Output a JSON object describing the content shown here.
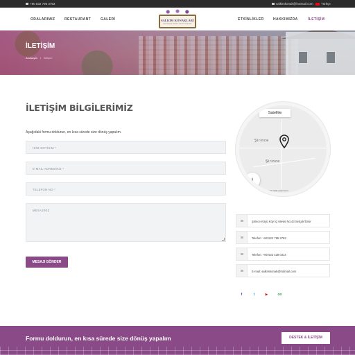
{
  "topbar": {
    "phone": "+90 532 795 3763",
    "email": "salkimkonak@hotmail.com",
    "language": "Türkçe"
  },
  "nav": {
    "left": [
      "ODALARIMIZ",
      "RESTAURANT",
      "GALERİ"
    ],
    "right": [
      "ETKİNLİKLER",
      "HAKKIMIZDA",
      "İLETİŞİM"
    ]
  },
  "logo": {
    "name": "SALKIM KONAKLARI",
    "tagline": "BOUTIQUE HOTEL & RESTAURANT"
  },
  "hero": {
    "title": "İLETİŞİM",
    "breadcrumb_home": "Anasayfa",
    "breadcrumb_sep": "/",
    "breadcrumb_current": "İletişim"
  },
  "contact": {
    "title": "İLETİŞİM BİLGİLERİMİZ",
    "intro": "Aşağıdaki formu doldurun, en kısa sürede size dönüş yapalım.",
    "name_placeholder": "İSİM SOYİSİM *",
    "email_placeholder": "E-MAİL ADRESİNİZ *",
    "phone_placeholder": "TELEFON NO *",
    "message_placeholder": "MESAJINIZ",
    "submit_label": "MESAJI GÖNDER"
  },
  "map": {
    "satellite_label": "Satellite",
    "place_label_1": "Şirince",
    "place_label_2": "Şirince",
    "attribution": "Google  Harita verileri  Terms"
  },
  "info": {
    "address": "Şirince Köyü Köy İçi Mevki No:43 Selçuk/İzmir",
    "phone1": "Telefon: +90 532 795 3763",
    "phone2": "Telefon: +90 532 428 0314",
    "email": "E-mail: salkimkonak@hotmail.com"
  },
  "social": [
    "f",
    "t",
    "▶",
    "oo"
  ],
  "cta": {
    "text": "Formu doldurun, en kısa sürede size dönüş yapalım",
    "button": "DESTEK & İLETİŞİM"
  },
  "colors": {
    "accent": "#8a4a87",
    "topbar": "#2b2b2b",
    "facebook": "#3b5998",
    "twitter": "#1da1f2",
    "youtube": "#cd201f",
    "tripadvisor": "#34a853"
  }
}
